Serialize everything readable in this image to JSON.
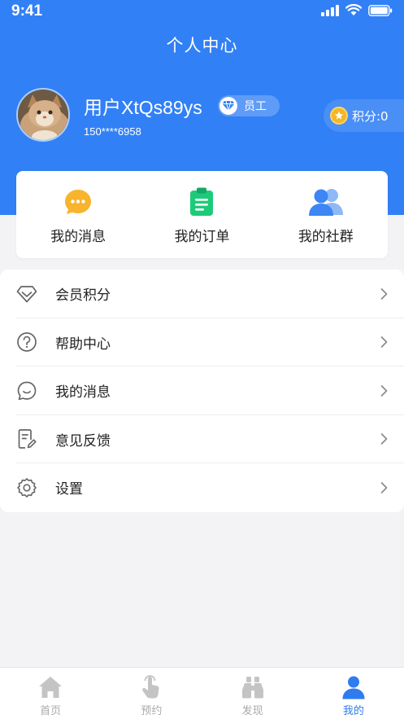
{
  "status_bar": {
    "time": "9:41"
  },
  "header": {
    "title": "个人中心"
  },
  "profile": {
    "username": "用户XtQs89ys",
    "role_badge": "员工",
    "phone": "150****6958",
    "points_label": "积分:0"
  },
  "quick_links": [
    {
      "label": "我的消息",
      "icon": "chat-bubble-icon",
      "color": "#f7b42c"
    },
    {
      "label": "我的订单",
      "icon": "clipboard-icon",
      "color": "#1ccb7a"
    },
    {
      "label": "我的社群",
      "icon": "group-icon",
      "color": "#4a8ff5"
    }
  ],
  "menu": [
    {
      "label": "会员积分",
      "icon": "diamond-icon"
    },
    {
      "label": "帮助中心",
      "icon": "help-icon"
    },
    {
      "label": "我的消息",
      "icon": "message-icon"
    },
    {
      "label": "意见反馈",
      "icon": "feedback-icon"
    },
    {
      "label": "设置",
      "icon": "settings-icon"
    }
  ],
  "tabbar": [
    {
      "label": "首页",
      "icon": "home-icon"
    },
    {
      "label": "预约",
      "icon": "tap-hand-icon"
    },
    {
      "label": "发现",
      "icon": "binoculars-icon"
    },
    {
      "label": "我的",
      "icon": "user-icon",
      "active": true
    }
  ],
  "colors": {
    "primary": "#3280f5",
    "background": "#f3f3f5",
    "tab_active": "#2f7cf0",
    "tab_inactive": "#c4c4c4"
  }
}
